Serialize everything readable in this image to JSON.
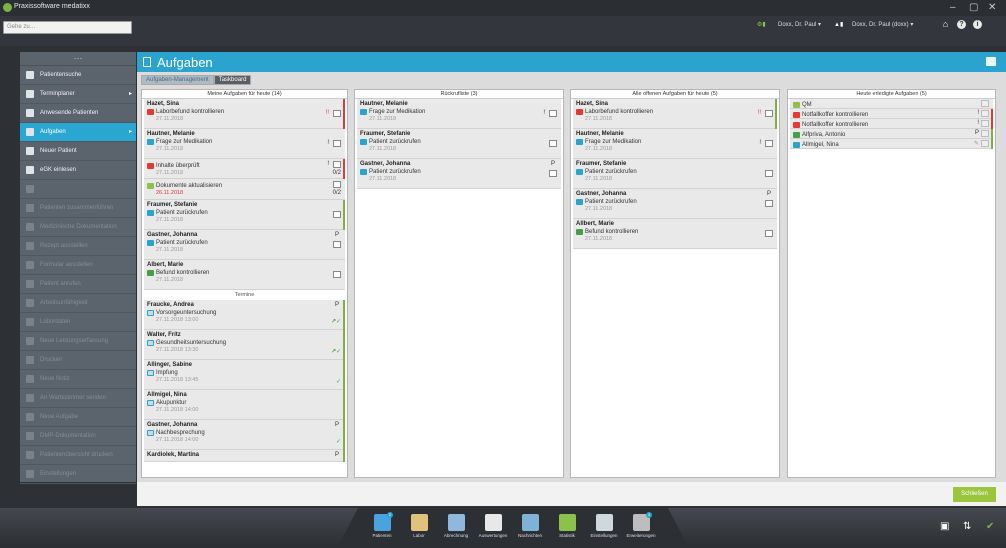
{
  "window": {
    "title": "Praxissoftware medatixx",
    "controls": [
      "–",
      "▢",
      "✕"
    ]
  },
  "toolbar": {
    "search_placeholder": "Gehe zu…",
    "user_left": "Doxx, Dr. Paul ▾",
    "user_right": "Doxx, Dr. Paul (doxx) ▾"
  },
  "sidebar": {
    "menu_glyph": "···",
    "items": [
      {
        "label": "Patientensuche",
        "icon": "person-search-icon",
        "active": false,
        "dim": false,
        "arrow": ""
      },
      {
        "label": "Terminplaner",
        "icon": "calendar-icon",
        "active": false,
        "dim": false,
        "arrow": "▸"
      },
      {
        "label": "Anwesende Patienten",
        "icon": "waiting-room-icon",
        "active": false,
        "dim": false,
        "arrow": ""
      },
      {
        "label": "Aufgaben",
        "icon": "tasks-icon",
        "active": true,
        "dim": false,
        "arrow": "▸"
      },
      {
        "label": "Neuer Patient",
        "icon": "new-patient-icon",
        "active": false,
        "dim": false,
        "arrow": ""
      },
      {
        "label": "eGK einlesen",
        "icon": "card-reader-icon",
        "active": false,
        "dim": false,
        "arrow": ""
      },
      {
        "label": "",
        "icon": "blank-icon",
        "active": false,
        "dim": true,
        "arrow": ""
      },
      {
        "label": "Patienten zusammenführen",
        "icon": "merge-icon",
        "active": false,
        "dim": true,
        "arrow": ""
      },
      {
        "label": "Medizinische Dokumentation",
        "icon": "document-icon",
        "active": false,
        "dim": true,
        "arrow": ""
      },
      {
        "label": "Rezept ausstellen",
        "icon": "prescription-icon",
        "active": false,
        "dim": true,
        "arrow": ""
      },
      {
        "label": "Formular ausstellen",
        "icon": "form-icon",
        "active": false,
        "dim": true,
        "arrow": ""
      },
      {
        "label": "Patient anrufen",
        "icon": "phone-icon",
        "active": false,
        "dim": true,
        "arrow": ""
      },
      {
        "label": "Arbeitsunfähigkeit",
        "icon": "au-icon",
        "active": false,
        "dim": true,
        "arrow": ""
      },
      {
        "label": "Labordaten",
        "icon": "lab-icon",
        "active": false,
        "dim": true,
        "arrow": ""
      },
      {
        "label": "Neue Leistungserfassung",
        "icon": "billing-icon",
        "active": false,
        "dim": true,
        "arrow": ""
      },
      {
        "label": "Drucken",
        "icon": "print-icon",
        "active": false,
        "dim": true,
        "arrow": ""
      },
      {
        "label": "Neue Notiz",
        "icon": "note-icon",
        "active": false,
        "dim": true,
        "arrow": ""
      },
      {
        "label": "An Wartezimmer senden",
        "icon": "send-icon",
        "active": false,
        "dim": true,
        "arrow": ""
      },
      {
        "label": "Neue Aufgabe",
        "icon": "new-task-icon",
        "active": false,
        "dim": true,
        "arrow": ""
      },
      {
        "label": "DMP-Dokumentation",
        "icon": "dmp-icon",
        "active": false,
        "dim": true,
        "arrow": ""
      },
      {
        "label": "Patientenübersicht drucken",
        "icon": "overview-icon",
        "active": false,
        "dim": true,
        "arrow": ""
      },
      {
        "label": "Einstellungen",
        "icon": "settings-icon",
        "active": false,
        "dim": true,
        "arrow": ""
      }
    ]
  },
  "header": {
    "title": "Aufgaben"
  },
  "tabs": [
    {
      "label": "Aufgaben-Management"
    },
    {
      "label": "Taskboard"
    }
  ],
  "columns": [
    {
      "title": "Meine Aufgaben für heute (14)"
    },
    {
      "title": "Rückrufliste (3)"
    },
    {
      "title": "Alle offenen Aufgaben für heute (5)"
    },
    {
      "title": "Heute erledigte Aufgaben (5)"
    }
  ],
  "col1": {
    "c1": {
      "name": "Hazet, Sina",
      "task": "Laborbefund kontrollieren",
      "date": "27.11.2018",
      "ind": "!!"
    },
    "c2": {
      "name": "Hautner, Melanie",
      "task": "Frage zur Medikation",
      "date": "27.11.2018",
      "ind": "!"
    },
    "c3": {
      "task": "Inhalte überprüft",
      "date": "27.11.2018",
      "ind": "!",
      "count": "0/2"
    },
    "c4": {
      "task": "Dokumente aktualisieren",
      "date": "26.11.2018",
      "count": "0/2"
    },
    "c5": {
      "name": "Fraumer, Stefanie",
      "task": "Patient zurückrufen",
      "date": "27.11.2018"
    },
    "c6": {
      "name": "Gastner, Johanna",
      "task": "Patient zurückrufen",
      "date": "27.11.2018",
      "ind": "P"
    },
    "c7": {
      "name": "Albert, Marie",
      "task": "Befund kontrollieren",
      "date": "27.11.2018"
    },
    "sep": "Termine",
    "a1": {
      "name": "Fraucke, Andrea",
      "task": "Vorsorgeuntersuchung",
      "date": "27.11.2018 13:00",
      "ind": "P"
    },
    "a2": {
      "name": "Walter, Fritz",
      "task": "Gesundheitsuntersuchung",
      "date": "27.11.2018 13:30"
    },
    "a3": {
      "name": "Allinger, Sabine",
      "task": "Impfung",
      "date": "27.11.2018 13:45"
    },
    "a4": {
      "name": "Allmigel, Nina",
      "task": "Akupunktur",
      "date": "27.11.2018 14:00"
    },
    "a5": {
      "name": "Gastner, Johanna",
      "task": "Nachbesprechung",
      "date": "27.11.2018 14:00",
      "ind": "P"
    },
    "a6": {
      "name": "Kardiolek, Martina",
      "ind": "P"
    }
  },
  "col2": {
    "c1": {
      "name": "Hautner, Melanie",
      "task": "Frage zur Medikation",
      "date": "27.11.2018",
      "ind": "!"
    },
    "c2": {
      "name": "Fraumer, Stefanie",
      "task": "Patient zurückrufen",
      "date": "27.11.2018"
    },
    "c3": {
      "name": "Gastner, Johanna",
      "task": "Patient zurückrufen",
      "date": "27.11.2018",
      "ind": "P"
    }
  },
  "col3": {
    "c1": {
      "name": "Hazet, Sina",
      "task": "Laborbefund kontrollieren",
      "date": "27.11.2018",
      "ind": "!!"
    },
    "c2": {
      "name": "Hautner, Melanie",
      "task": "Frage zur Medikation",
      "date": "27.11.2018",
      "ind": "!"
    },
    "c3": {
      "name": "Fraumer, Stefanie",
      "task": "Patient zurückrufen",
      "date": "27.11.2018"
    },
    "c4": {
      "name": "Gastner, Johanna",
      "task": "Patient zurückrufen",
      "date": "27.11.2018",
      "ind": "P"
    },
    "c5": {
      "name": "Allbert, Marie",
      "task": "Befund kontrollieren",
      "date": "27.11.2018"
    }
  },
  "col4": {
    "r1": {
      "label": "QM"
    },
    "r2": {
      "label": "Notfallkoffer kontrollieren",
      "ind": "!"
    },
    "r3": {
      "label": "Notfallkoffer kontrollieren",
      "ind": "!"
    },
    "r4": {
      "label": "Alfpriva, Antonio",
      "ind": "P"
    },
    "r5": {
      "label": "Allmigel, Nina"
    }
  },
  "footer": {
    "close_label": "Schließen"
  },
  "dock": [
    {
      "label": "Patienten",
      "color": "#4aa3df",
      "badge": "2"
    },
    {
      "label": "Labor",
      "color": "#e0c27a",
      "badge": ""
    },
    {
      "label": "Abrechnung",
      "color": "#8fb8de",
      "badge": ""
    },
    {
      "label": "Auswertungen",
      "color": "#e8e8e8",
      "badge": ""
    },
    {
      "label": "Nachrichten",
      "color": "#7fb3d5",
      "badge": ""
    },
    {
      "label": "Statistik",
      "color": "#8bc34a",
      "badge": ""
    },
    {
      "label": "Einstellungen",
      "color": "#cfd8dc",
      "badge": ""
    },
    {
      "label": "Erweiterungen",
      "color": "#bdbdbd",
      "badge": "3"
    }
  ],
  "colors": {
    "accent": "#2aa4cf",
    "green": "#9bc53d",
    "red": "#e53935",
    "sidebar": "#5b636c"
  }
}
